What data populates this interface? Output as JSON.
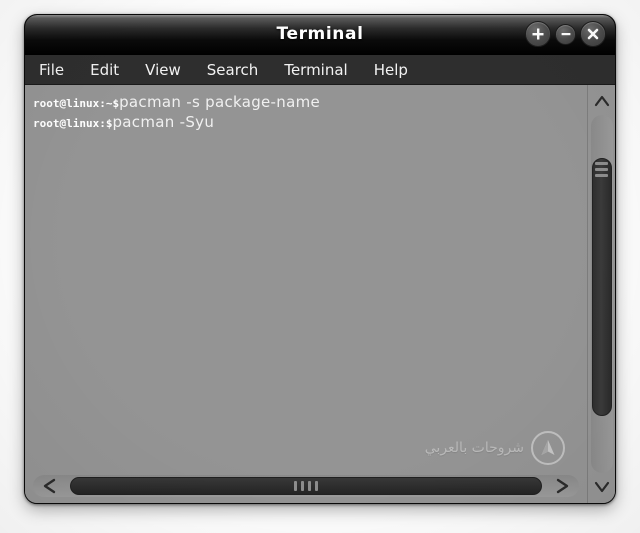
{
  "window": {
    "title": "Terminal",
    "buttons": [
      {
        "name": "maximize-button",
        "icon": "plus-icon",
        "label": "+"
      },
      {
        "name": "minimize-button",
        "icon": "minus-icon",
        "label": "−"
      },
      {
        "name": "close-button",
        "icon": "close-icon",
        "label": "×"
      }
    ]
  },
  "menubar": {
    "items": [
      {
        "label": "File"
      },
      {
        "label": "Edit"
      },
      {
        "label": "View"
      },
      {
        "label": "Search"
      },
      {
        "label": "Terminal"
      },
      {
        "label": "Help"
      }
    ]
  },
  "terminal": {
    "lines": [
      {
        "prompt": "root@linux:~$",
        "command": "pacman -s package-name"
      },
      {
        "prompt": "root@linux:$",
        "command": "pacman -Syu"
      }
    ]
  },
  "watermark": {
    "text": "شروحات بالعربي",
    "logo": "arch-logo-icon"
  },
  "scrollbars": {
    "vertical": {
      "up_arrow": "∧",
      "down_arrow": "∨"
    },
    "horizontal": {
      "left_arrow": "<",
      "right_arrow": ">"
    }
  },
  "colors": {
    "terminal_background": "#949494",
    "menubar_background": "#2e2e2e",
    "titlebar_top": "#8f8f8f",
    "titlebar_bottom": "#000000",
    "text": "#ffffff",
    "scroll_thumb": "#2d2d2d"
  }
}
